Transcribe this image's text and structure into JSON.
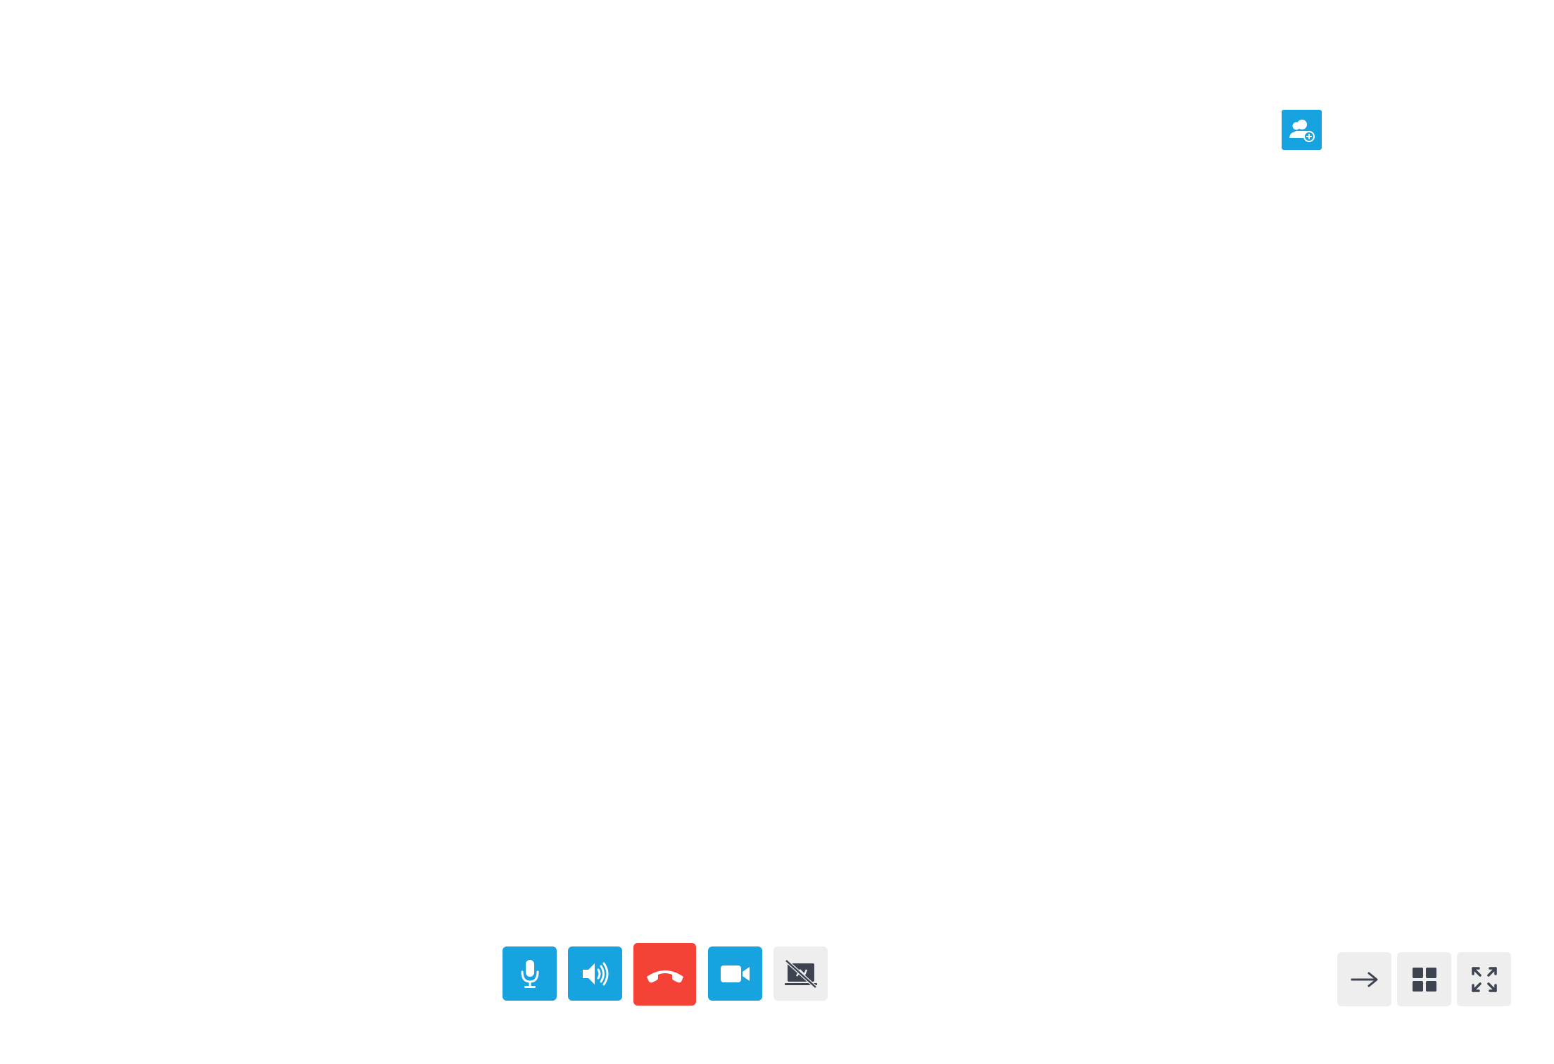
{
  "colors": {
    "accent": "#17a2e0",
    "danger": "#f44336",
    "neutral": "#eeeeef",
    "icon_dark": "#3d4450",
    "background": "#ffffff"
  },
  "toolbar_top": {
    "add_participant": {
      "icon": "add-user-icon",
      "label": ""
    }
  },
  "call_controls": [
    {
      "id": "mic",
      "icon": "microphone-icon",
      "state": "on"
    },
    {
      "id": "speaker",
      "icon": "speaker-icon",
      "state": "on"
    },
    {
      "id": "hangup",
      "icon": "phone-hangup-icon",
      "state": "active"
    },
    {
      "id": "camera",
      "icon": "video-camera-icon",
      "state": "on"
    },
    {
      "id": "screen_share",
      "icon": "screen-share-off-icon",
      "state": "off"
    }
  ],
  "view_controls": [
    {
      "id": "exit",
      "icon": "arrow-right-icon"
    },
    {
      "id": "grid",
      "icon": "grid-icon"
    },
    {
      "id": "fullscreen",
      "icon": "expand-icon"
    }
  ]
}
